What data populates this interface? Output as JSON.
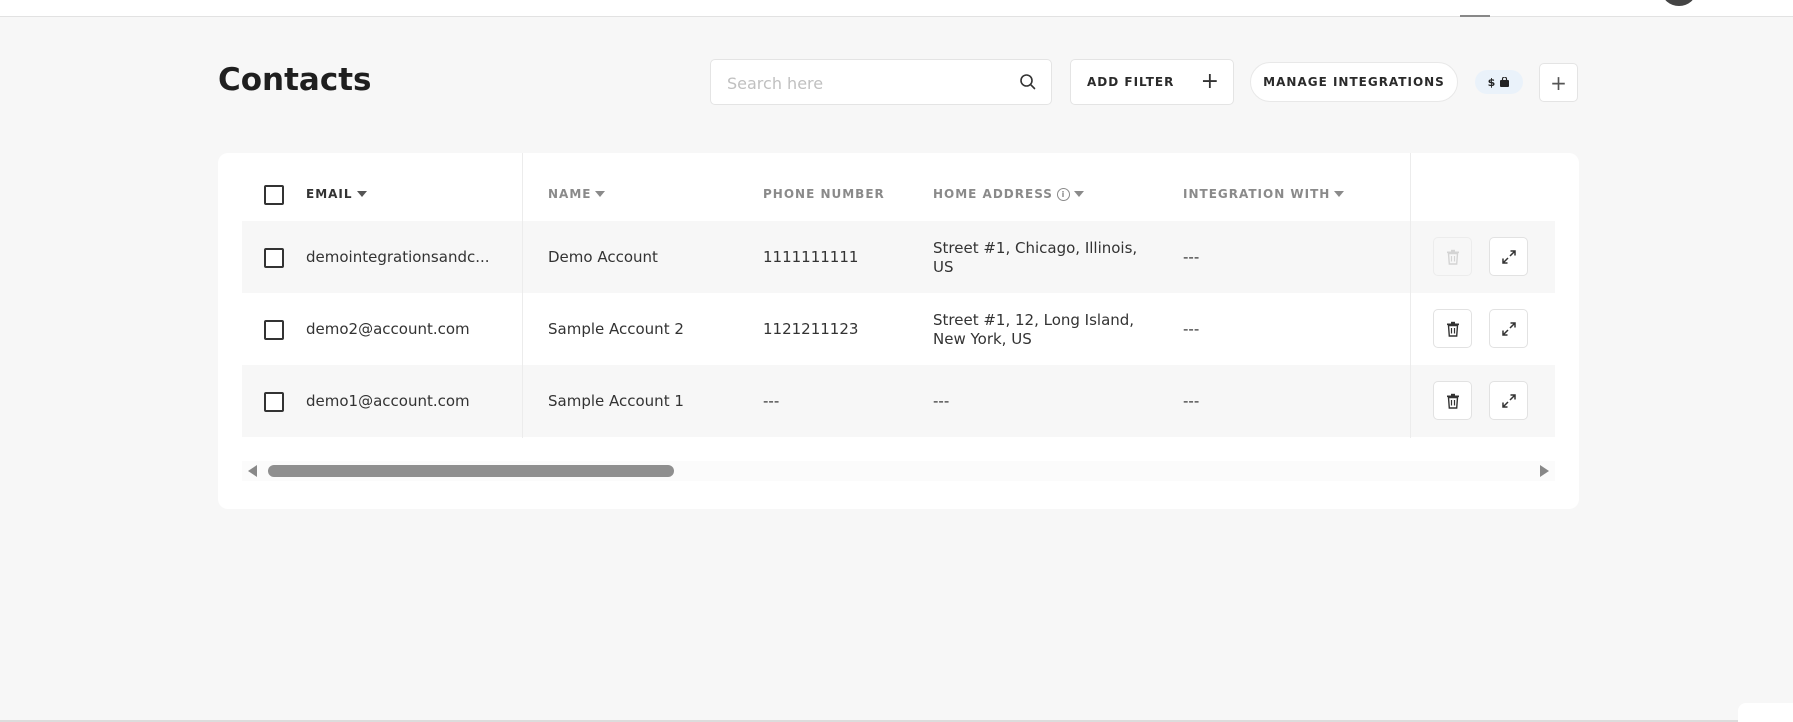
{
  "page": {
    "title": "Contacts"
  },
  "toolbar": {
    "search_placeholder": "Search here",
    "search_value": "",
    "add_filter_label": "ADD FILTER",
    "manage_integrations_label": "MANAGE INTEGRATIONS",
    "wallet_symbol": "$",
    "plus_symbol": "+"
  },
  "table": {
    "columns": {
      "email": "EMAIL",
      "name": "NAME",
      "phone": "PHONE NUMBER",
      "address": "HOME ADDRESS",
      "integration": "INTEGRATION WITH"
    },
    "rows": [
      {
        "email": "demointegrationsandc...",
        "name": "Demo Account",
        "phone": "1111111111",
        "address_line1": "Street #1, Chicago, Illinois,",
        "address_line2": "US",
        "integration": "---",
        "delete_disabled": true
      },
      {
        "email": "demo2@account.com",
        "name": "Sample Account 2",
        "phone": "1121211123",
        "address_line1": "Street #1, 12, Long Island,",
        "address_line2": "New York, US",
        "integration": "---",
        "delete_disabled": false
      },
      {
        "email": "demo1@account.com",
        "name": "Sample Account 1",
        "phone": "---",
        "address_line1": "---",
        "address_line2": "",
        "integration": "---",
        "delete_disabled": false
      }
    ]
  },
  "icons": {
    "search": "search-icon",
    "add_filter": "plus-icon",
    "wallet": "wallet-icon",
    "info": "info-icon",
    "sort": "caret-down-icon",
    "delete": "trash-icon",
    "expand": "expand-icon"
  },
  "colors": {
    "row_shade": "#f7f7f7",
    "pill_bg": "#eaf2fa",
    "text": "#333333",
    "header_text": "#8a8a8a"
  }
}
